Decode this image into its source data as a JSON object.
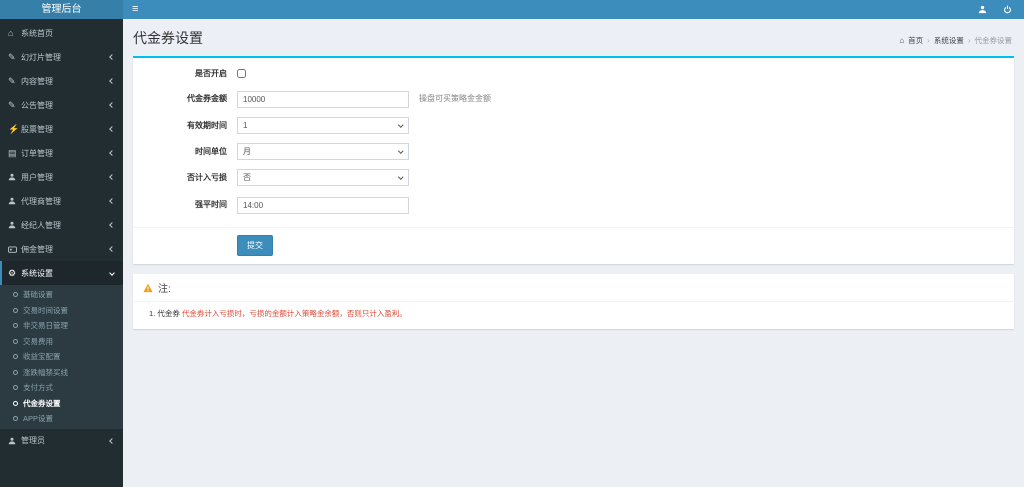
{
  "navbar": {
    "brand": "管理后台"
  },
  "icons": {
    "hamburger": "≡",
    "home": "⌂",
    "edit": "✎",
    "bolt": "⚡",
    "book": "▤",
    "gear": "⚙",
    "breadcrumb_home": "⌂",
    "breadcrumb_sep": "›"
  },
  "sidebar": {
    "items": [
      {
        "label": "系统首页"
      },
      {
        "label": "幻灯片管理"
      },
      {
        "label": "内容管理"
      },
      {
        "label": "公告管理"
      },
      {
        "label": "股票管理"
      },
      {
        "label": "订单管理"
      },
      {
        "label": "用户管理"
      },
      {
        "label": "代理商管理"
      },
      {
        "label": "经纪人管理"
      },
      {
        "label": "佣金管理"
      },
      {
        "label": "系统设置"
      },
      {
        "label": "管理员"
      }
    ],
    "system_submenu": [
      {
        "label": "基础设置"
      },
      {
        "label": "交易时间设置"
      },
      {
        "label": "非交易日管理"
      },
      {
        "label": "交易费用"
      },
      {
        "label": "收益宝配置"
      },
      {
        "label": "涨跌幅禁买线"
      },
      {
        "label": "支付方式"
      },
      {
        "label": "代金券设置",
        "active": true
      },
      {
        "label": "APP设置"
      }
    ]
  },
  "page": {
    "title": "代金券设置",
    "breadcrumb": {
      "home": "首页",
      "section": "系统设置",
      "current": "代金券设置"
    }
  },
  "form": {
    "fields": [
      {
        "label": "是否开启",
        "type": "checkbox",
        "checked": false
      },
      {
        "label": "代金券金额",
        "value": "10000",
        "helper": "操盘可买策略金金额"
      },
      {
        "label": "有效期时间",
        "value": "1",
        "type": "select"
      },
      {
        "label": "时间单位",
        "value": "月",
        "type": "select"
      },
      {
        "label": "否计入亏损",
        "value": "否",
        "type": "select"
      },
      {
        "label": "强平时间",
        "value": "14:00"
      }
    ],
    "submit_label": "提交"
  },
  "note": {
    "heading": "注:",
    "items": [
      {
        "label": "1. 代金券",
        "text": "代金券计入亏损时，亏损的金额计入策略金余额，否则只计入盈利。"
      }
    ]
  },
  "colors": {
    "navbar": "#3c8dbc",
    "brand_bg": "#367fa9",
    "sidebar_bg": "#222d32",
    "box_accent": "#00c0ef",
    "button": "#3c8dbc",
    "warning": "#f39c12",
    "note_red": "#dd4b39"
  }
}
